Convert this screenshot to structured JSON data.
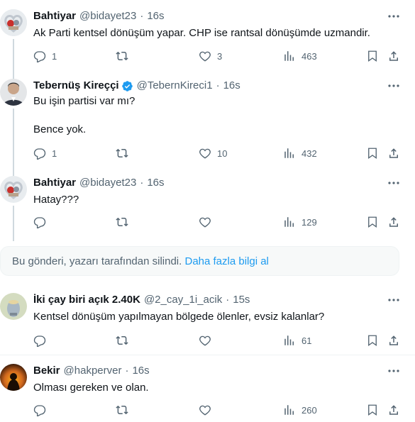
{
  "tweets": [
    {
      "name": "Bahtiyar",
      "handle": "@bidayet23",
      "time": "16s",
      "text": "Ak Parti kentsel dönüşüm yapar. CHP ise rantsal dönüşümde uzmandir.",
      "replies": "1",
      "retweets": "",
      "likes": "3",
      "views": "463"
    },
    {
      "name": "Tebernüş Kireççi",
      "handle": "@TebernKireci1",
      "time": "16s",
      "text": "Bu işin partisi var mı?\n\nBence yok.",
      "replies": "1",
      "retweets": "",
      "likes": "10",
      "views": "432"
    },
    {
      "name": "Bahtiyar",
      "handle": "@bidayet23",
      "time": "16s",
      "text": "Hatay???",
      "replies": "",
      "retweets": "",
      "likes": "",
      "views": "129"
    },
    {
      "name": "İki çay biri açık 2.40K",
      "handle": "@2_cay_1i_acik",
      "time": "15s",
      "text": "Kentsel dönüşüm yapılmayan bölgede ölenler, evsiz kalanlar?",
      "replies": "",
      "retweets": "",
      "likes": "",
      "views": "61"
    },
    {
      "name": "Bekir",
      "handle": "@hakperver",
      "time": "16s",
      "text": "Olması gereken ve olan.",
      "replies": "",
      "retweets": "",
      "likes": "",
      "views": "260"
    }
  ],
  "deleted_notice": {
    "text": "Bu gönderi, yazarı tarafından silindi.",
    "link": "Daha fazla bilgi al"
  },
  "colors": {
    "text": "#0f1419",
    "secondary": "#536471",
    "accent": "#1d9bf0",
    "thread_line": "#cfd9de"
  },
  "icons": [
    "more-icon",
    "reply-icon",
    "retweet-icon",
    "like-icon",
    "views-icon",
    "bookmark-icon",
    "share-icon",
    "verified-icon"
  ]
}
